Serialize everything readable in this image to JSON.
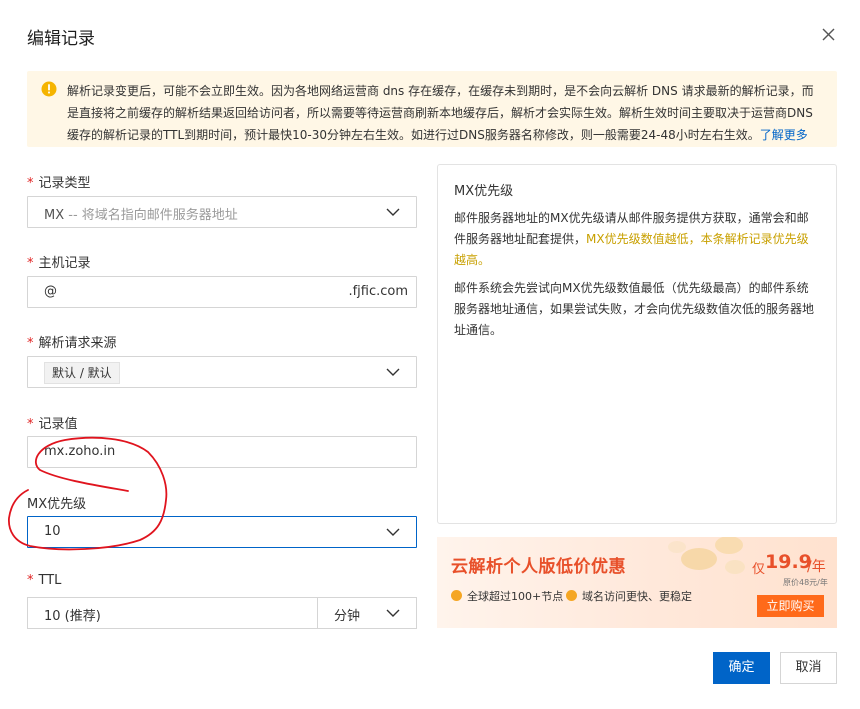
{
  "dialog": {
    "title": "编辑记录",
    "close_icon": "close-icon"
  },
  "alert": {
    "icon": "warning-icon",
    "text": "解析记录变更后，可能不会立即生效。因为各地网络运营商 dns 存在缓存，在缓存未到期时，是不会向云解析 DNS 请求最新的解析记录，而是直接将之前缓存的解析结果返回给访问者，所以需要等待运营商刷新本地缓存后，解析才会实际生效。解析生效时间主要取决于运营商DNS缓存的解析记录的TTL到期时间，预计最快10-30分钟左右生效。如进行过DNS服务器名称修改，则一般需要24-48小时左右生效。",
    "link": "了解更多"
  },
  "form": {
    "record_type": {
      "label": "记录类型",
      "value": "MX",
      "hint": "-- 将域名指向邮件服务器地址"
    },
    "host": {
      "label": "主机记录",
      "value": "@",
      "suffix": ".fjfic.com"
    },
    "line": {
      "label": "解析请求来源",
      "value": "默认 / 默认"
    },
    "record_value": {
      "label": "记录值",
      "value": "mx.zoho.in"
    },
    "mx_priority": {
      "label": "MX优先级",
      "value": "10"
    },
    "ttl": {
      "label": "TTL",
      "value": "10 (推荐)",
      "unit": "分钟"
    }
  },
  "help": {
    "title": "MX优先级",
    "p1_a": "邮件服务器地址的MX优先级请从邮件服务提供方获取，通常会和邮件服务器地址配套提供，",
    "p1_b": "MX优先级数值越低，本条解析记录优先级越高。",
    "p2": "邮件系统会先尝试向MX优先级数值最低（优先级最高）的邮件系统服务器地址通信，如果尝试失败，才会向优先级数值次低的服务器地址通信。"
  },
  "promo": {
    "title": "云解析个人版低价优惠",
    "feature1": "全球超过100+节点",
    "feature2": "域名访问更快、更稳定",
    "price_prefix": "仅",
    "price": "19.9",
    "price_unit": "/年",
    "original_price": "原价48元/年",
    "buy": "立即购买"
  },
  "buttons": {
    "confirm": "确定",
    "cancel": "取消"
  },
  "colors": {
    "primary": "#0064c8",
    "alert_bg": "#fff7e6",
    "highlight": "#c8a000",
    "promo_accent": "#e8502a",
    "annotation": "#e0141e"
  }
}
